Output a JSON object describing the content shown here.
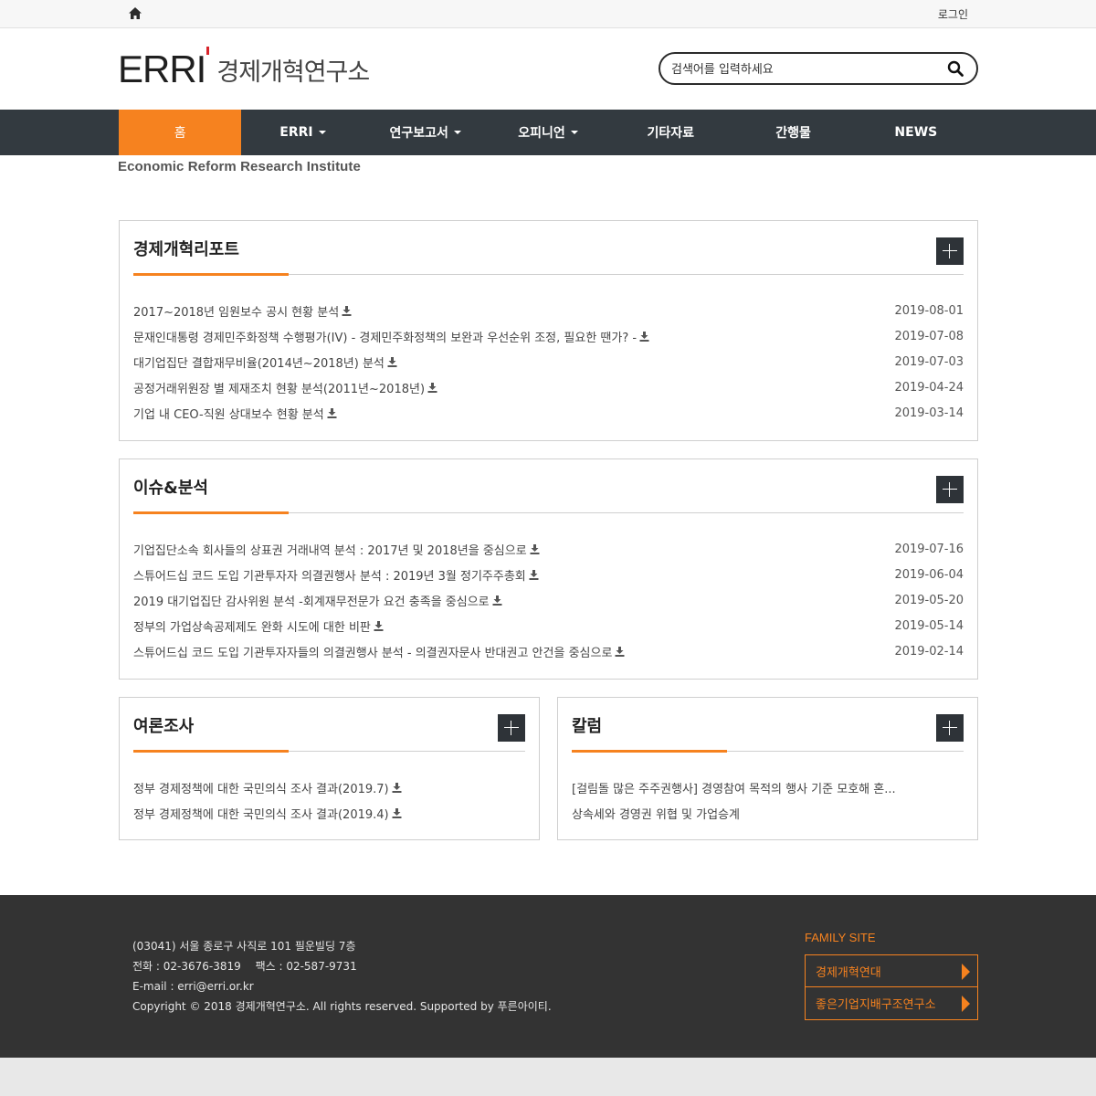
{
  "topbar": {
    "login": "로그인",
    "home_icon": "home-icon"
  },
  "logo": {
    "en": "ERRI",
    "ko": "경제개혁연구소"
  },
  "search": {
    "placeholder": "검색어를 입력하세요",
    "icon": "search-icon"
  },
  "nav": {
    "items": [
      {
        "label": "홈",
        "active": true
      },
      {
        "label": "ERRI",
        "dropdown": true
      },
      {
        "label": "연구보고서",
        "dropdown": true
      },
      {
        "label": "오피니언",
        "dropdown": true
      },
      {
        "label": "기타자료"
      },
      {
        "label": "간행물"
      },
      {
        "label": "NEWS"
      }
    ]
  },
  "tagline": "Economic Reform Research Institute",
  "panels": {
    "report": {
      "title": "경제개혁리포트",
      "items": [
        {
          "text": "2017~2018년 임원보수 공시 현황 분석",
          "date": "2019-08-01"
        },
        {
          "text": "문재인대통령 경제민주화정책 수행평가(IV) - 경제민주화정책의 보완과 우선순위 조정, 필요한 땐가? -",
          "date": "2019-07-08"
        },
        {
          "text": "대기업집단 결합재무비율(2014년~2018년) 분석",
          "date": "2019-07-03"
        },
        {
          "text": "공정거래위원장 별 제재조치 현황 분석(2011년~2018년)",
          "date": "2019-04-24"
        },
        {
          "text": "기업 내 CEO-직원 상대보수 현황 분석",
          "date": "2019-03-14"
        }
      ]
    },
    "issue": {
      "title": "이슈&분석",
      "items": [
        {
          "text": "기업집단소속 회사들의 상표권 거래내역 분석 : 2017년 및 2018년을 중심으로",
          "date": "2019-07-16"
        },
        {
          "text": "스튜어드십 코드 도입 기관투자자 의결권행사 분석 : 2019년 3월 정기주주총회",
          "date": "2019-06-04"
        },
        {
          "text": "2019 대기업집단 감사위원 분석 -회계재무전문가 요건 충족을 중심으로",
          "date": "2019-05-20"
        },
        {
          "text": "정부의 가업상속공제제도 완화 시도에 대한 비판",
          "date": "2019-05-14"
        },
        {
          "text": "스튜어드십 코드 도입 기관투자자들의 의결권행사 분석 - 의결권자문사 반대권고 안건을 중심으로",
          "date": "2019-02-14"
        }
      ]
    },
    "survey": {
      "title": "여론조사",
      "items": [
        {
          "text": "정부 경제정책에 대한 국민의식 조사 결과(2019.7)"
        },
        {
          "text": "정부 경제정책에 대한 국민의식 조사 결과(2019.4)"
        }
      ]
    },
    "column": {
      "title": "칼럼",
      "items": [
        {
          "text": "[걸림돌 많은 주주권행사] 경영참여 목적의 행사 기준 모호해 혼..."
        },
        {
          "text": "상속세와 경영권 위협 및 가업승계"
        }
      ]
    }
  },
  "footer": {
    "address": "(03041) 서울 종로구 사직로 101 필운빌딩 7층",
    "phone": "전화 : 02-3676-3819　 팩스 : 02-587-9731",
    "email": "E-mail : erri@erri.or.kr",
    "copyright": "Copyright © 2018 경제개혁연구소. All rights reserved. Supported by 푸른아이티.",
    "family_title": "FAMILY SITE",
    "family_sites": [
      "경제개혁연대",
      "좋은기업지배구조연구소"
    ]
  },
  "colors": {
    "accent": "#f6821f",
    "nav_bg": "#333a40",
    "footer_bg": "#333333",
    "logo_mark": "#d8242b"
  }
}
